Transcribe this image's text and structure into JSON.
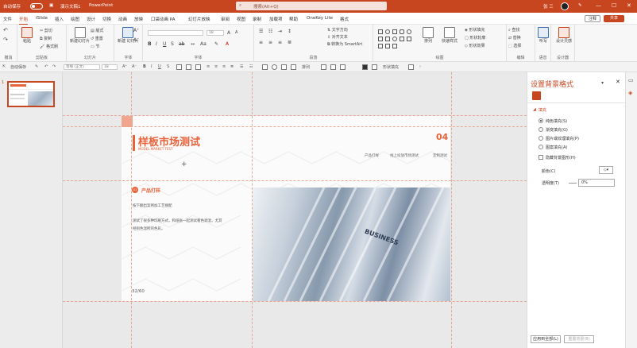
{
  "titlebar": {
    "autosave": "自动保存",
    "doc_title": "演示文稿1",
    "app_name": "PowerPoint",
    "search_placeholder": "搜索(Alt+Q)",
    "user": "张 三",
    "minimize": "—",
    "maximize": "☐",
    "close": "✕"
  },
  "menu": {
    "tabs": [
      "文件",
      "开始",
      "iSlide",
      "插入",
      "绘图",
      "设计",
      "切换",
      "动画",
      "放映",
      "口袋动画 PA",
      "幻灯片放映",
      "审阅",
      "视图",
      "录制",
      "加载项",
      "帮助",
      "OneKey Lite",
      "格式"
    ],
    "active_index": 1,
    "comment": "注释",
    "share": "共享"
  },
  "ribbon": {
    "groups": [
      "撤消",
      "剪贴板",
      "幻灯片",
      "字体",
      "段落",
      "绘图",
      "编辑",
      "语音",
      "设计器"
    ],
    "clipboard": {
      "paste": "粘贴",
      "cut": "剪切",
      "copy": "复制",
      "format_painter": "格式刷"
    },
    "slides": {
      "new_slide": "新建幻灯片",
      "layout": "版式",
      "reset": "重置",
      "section": "节"
    },
    "font": {
      "font_name": "",
      "font_size": "18"
    },
    "paragraph": {
      "text_direction": "文字方向",
      "align_text": "对齐文本",
      "smartart": "转换为 SmartArt"
    },
    "drawing": {
      "arrange": "排列",
      "quick_styles": "快速样式",
      "fill": "形状填充",
      "outline": "形状轮廓",
      "effect": "形状效果"
    },
    "editing": {
      "find": "查找",
      "replace": "替换",
      "select": "选择"
    },
    "voice": {
      "dictate": "听写"
    },
    "designer": {
      "design_ideas": "设计灵感"
    },
    "new_slide": "新建 幻灯片"
  },
  "qat": {
    "autosave": "自动保存",
    "font_name": "等线 (正文)",
    "font_size": "18",
    "arrange": "排列",
    "shape_fill": "形状填充"
  },
  "thumbs": {
    "num": "1"
  },
  "slide": {
    "title": "样板市场测试",
    "subtitle": "MODEL MARKET TEST",
    "page_num": "04",
    "nav": [
      "产品打样",
      "线上投放市场测试",
      "定制测试"
    ],
    "section_icon": "01",
    "section_title": "产品打样",
    "section_sub": "按下翻出案例加工艺搜配",
    "body": "测试了很多种印刷方式，和纸张一起测试看色调温，尤其经别色温所的色彩。",
    "page_counter": "32/60",
    "photo_text": "BUSINESS"
  },
  "format_pane": {
    "title": "设置背景格式",
    "section": "填充",
    "options": [
      "纯色填充(S)",
      "渐变填充(G)",
      "图片或纹理填充(P)",
      "图案填充(A)"
    ],
    "selected_option": 0,
    "hide_bg": "隐藏背景图形(H)",
    "color_label": "颜色(C)",
    "transparency_label": "透明度(T)",
    "transparency_value": "0%",
    "apply_all": "应用到全部(L)",
    "reset_bg": "重置背景(B)"
  },
  "colors": {
    "accent": "#c7451f",
    "slide_orange": "#e8623a"
  }
}
